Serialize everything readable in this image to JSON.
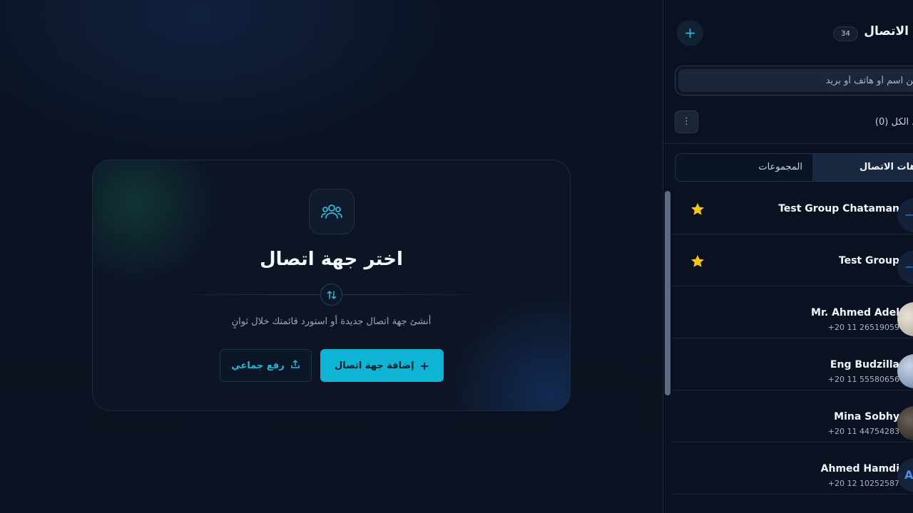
{
  "main": {
    "title": "اختر جهة اتصال",
    "subtitle": "أنشئ جهة اتصال جديدة أو استورد قائمتك خلال ثوانٍ",
    "add_contact_label": "إضافة جهة اتصال",
    "bulk_upload_label": "رفع جماعي"
  },
  "sidebar": {
    "title": "الاتصال",
    "count": "34",
    "search_placeholder": "بحث عن اسم أو هاتف أو بريد",
    "select_all": "د الكل (0)",
    "tabs": {
      "contacts": "هات الاتصال",
      "groups": "المجموعات"
    },
    "contacts": [
      {
        "name": "Test Group Chataman",
        "phone": "",
        "type": "group",
        "starred": true
      },
      {
        "name": "Test Group",
        "phone": "",
        "type": "group",
        "starred": true
      },
      {
        "name": "Mr. Ahmed Adel",
        "phone": "+20 11 26519059",
        "type": "photo",
        "starred": false
      },
      {
        "name": "Eng Budzilla",
        "phone": "+20 11 55580656",
        "type": "photo",
        "starred": false
      },
      {
        "name": "Mina Sobhy",
        "phone": "+20 11 44754283",
        "type": "photo",
        "starred": false
      },
      {
        "name": "Ahmed Hamdi",
        "phone": "+20 12 10252587",
        "type": "letter",
        "initial": "A",
        "starred": false
      }
    ]
  },
  "colors": {
    "accent": "#0fb3d4",
    "star": "#f5c518",
    "background": "#0a1120"
  }
}
